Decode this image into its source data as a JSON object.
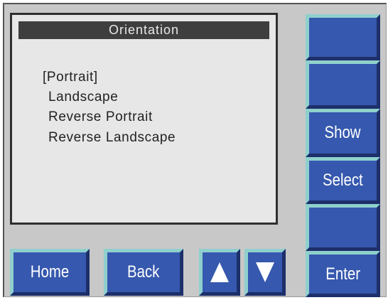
{
  "screen": {
    "title": "Orientation",
    "options": [
      {
        "label": "[Portrait]",
        "selected": true
      },
      {
        "label": "Landscape",
        "selected": false
      },
      {
        "label": "Reverse Portrait",
        "selected": false
      },
      {
        "label": "Reverse Landscape",
        "selected": false
      }
    ]
  },
  "side_buttons": {
    "blank1": "",
    "blank2": "",
    "show": "Show",
    "select": "Select",
    "blank3": "",
    "enter": "Enter"
  },
  "bottom_buttons": {
    "home": "Home",
    "back": "Back",
    "up_icon": "up-arrow",
    "down_icon": "down-arrow"
  },
  "colors": {
    "button_face": "#3658ae",
    "button_highlight": "#8fd0cd",
    "button_shadow": "#1d2f6a",
    "screen_bg": "#e7e7e7",
    "title_bar": "#3e3e3e"
  }
}
